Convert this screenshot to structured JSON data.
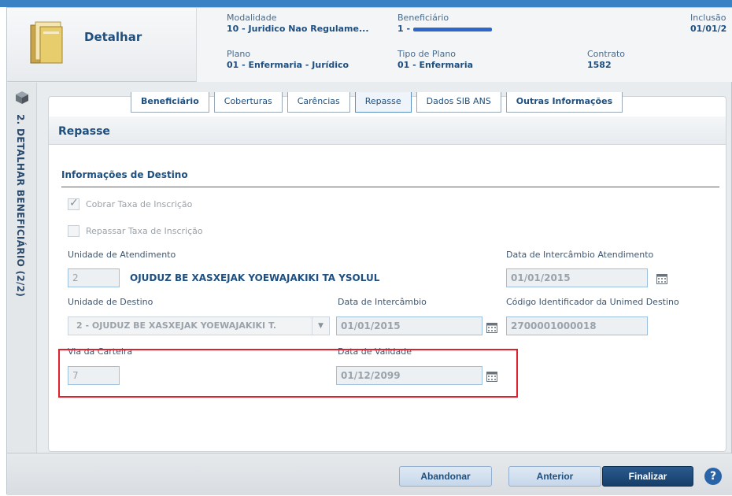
{
  "header": {
    "title": "Detalhar",
    "modalidade": {
      "label": "Modalidade",
      "value": "10 - Juridico Nao Regulame..."
    },
    "beneficiario": {
      "label": "Beneficiário",
      "value": "1 - "
    },
    "inclusao": {
      "label": "Inclusão",
      "value": "01/01/2"
    },
    "plano": {
      "label": "Plano",
      "value": "01 - Enfermaria - Jurídico"
    },
    "tipo_plano": {
      "label": "Tipo de Plano",
      "value": "01 - Enfermaria"
    },
    "contrato": {
      "label": "Contrato",
      "value": "1582"
    }
  },
  "sidebar": {
    "vertical_title": "2. DETALHAR BENEFICIÁRIO (2/2)"
  },
  "tabs": [
    {
      "label": "Beneficiário"
    },
    {
      "label": "Coberturas"
    },
    {
      "label": "Carências"
    },
    {
      "label": "Repasse"
    },
    {
      "label": "Dados SIB ANS"
    },
    {
      "label": "Outras Informações"
    }
  ],
  "section": {
    "title": "Repasse",
    "subtitle": "Informações de Destino"
  },
  "form": {
    "cobrar_taxa": "Cobrar Taxa de Inscrição",
    "repassar_taxa": "Repassar Taxa de Inscrição",
    "unidade_atendimento": {
      "label": "Unidade de Atendimento",
      "code": "2",
      "name": "OJUDUZ BE XASXEJAK YOEWAJAKIKI TA YSOLUL"
    },
    "data_intercambio_atendimento": {
      "label": "Data de Intercâmbio Atendimento",
      "value": "01/01/2015"
    },
    "unidade_destino": {
      "label": "Unidade de Destino",
      "value": "2 - OJUDUZ BE XASXEJAK YOEWAJAKIKI T."
    },
    "data_intercambio": {
      "label": "Data de Intercâmbio",
      "value": "01/01/2015"
    },
    "codigo_unimed": {
      "label": "Código Identificador da Unimed Destino",
      "value": "2700001000018"
    },
    "via_carteira": {
      "label": "Via da Carteira",
      "value": "7"
    },
    "data_validade": {
      "label": "Data de Validade",
      "value": "01/12/2099"
    }
  },
  "footer": {
    "abandonar": "Abandonar",
    "anterior": "Anterior",
    "finalizar": "Finalizar",
    "help": "?"
  },
  "icons": {
    "folder": "folder-icon",
    "cube": "cube-icon",
    "calendar": "calendar-icon",
    "help": "help-icon"
  }
}
